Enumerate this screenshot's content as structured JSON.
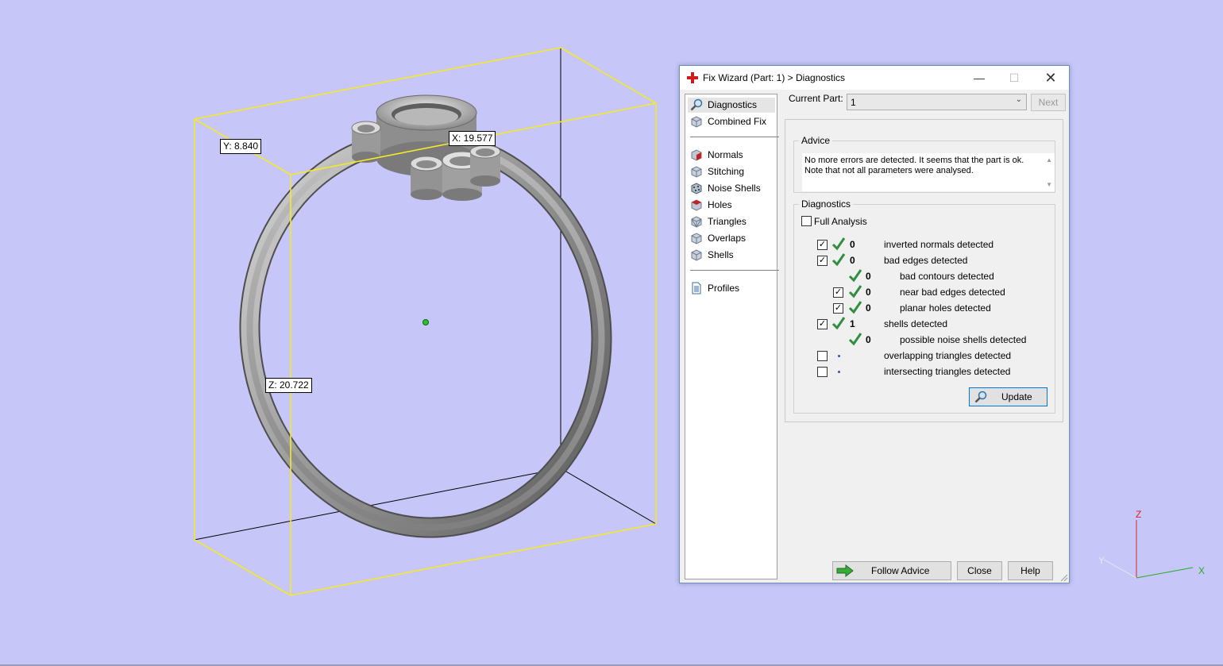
{
  "viewport": {
    "labels": {
      "y": "Y: 8.840",
      "x": "X: 19.577",
      "z": "Z: 20.722"
    },
    "axes": {
      "z": "Z",
      "y": "Y",
      "x": "X"
    }
  },
  "dialog": {
    "title": "Fix Wizard (Part: 1) > Diagnostics",
    "nav": {
      "top": [
        {
          "label": "Diagnostics",
          "icon": "magnifier-icon",
          "selected": true
        },
        {
          "label": "Combined Fix",
          "icon": "cube-icon"
        }
      ],
      "middle": [
        {
          "label": "Normals",
          "icon": "normals-cube-icon"
        },
        {
          "label": "Stitching",
          "icon": "stitching-cube-icon"
        },
        {
          "label": "Noise Shells",
          "icon": "noise-shells-icon"
        },
        {
          "label": "Holes",
          "icon": "holes-cube-icon"
        },
        {
          "label": "Triangles",
          "icon": "triangles-cube-icon"
        },
        {
          "label": "Overlaps",
          "icon": "overlaps-cube-icon"
        },
        {
          "label": "Shells",
          "icon": "shells-cube-icon"
        }
      ],
      "bottom": [
        {
          "label": "Profiles",
          "icon": "document-icon"
        }
      ]
    },
    "current_part_label": "Current Part:",
    "current_part_value": "1",
    "next_label": "Next",
    "advice_title": "Advice",
    "advice_text": "No more errors are detected. It seems that the part is ok. Note that not all parameters were analysed.",
    "diagnostics_title": "Diagnostics",
    "full_analysis_label": "Full Analysis",
    "rows": [
      {
        "checkbox": true,
        "checked": true,
        "status": "ok",
        "count": "0",
        "label": "inverted normals detected",
        "indent": 0
      },
      {
        "checkbox": true,
        "checked": true,
        "status": "ok",
        "count": "0",
        "label": "bad edges detected",
        "indent": 0
      },
      {
        "checkbox": false,
        "checked": false,
        "status": "ok",
        "count": "0",
        "label": "bad contours detected",
        "indent": 1
      },
      {
        "checkbox": true,
        "checked": true,
        "status": "ok",
        "count": "0",
        "label": "near bad edges detected",
        "indent": 1
      },
      {
        "checkbox": true,
        "checked": true,
        "status": "ok",
        "count": "0",
        "label": "planar holes detected",
        "indent": 1
      },
      {
        "checkbox": true,
        "checked": true,
        "status": "ok",
        "count": "1",
        "label": "shells detected",
        "indent": 0
      },
      {
        "checkbox": false,
        "checked": false,
        "status": "ok",
        "count": "0",
        "label": "possible noise shells detected",
        "indent": 1
      },
      {
        "checkbox": true,
        "checked": false,
        "status": "dot",
        "count": "",
        "label": "overlapping triangles detected",
        "indent": 0
      },
      {
        "checkbox": true,
        "checked": false,
        "status": "dot",
        "count": "",
        "label": "intersecting triangles detected",
        "indent": 0
      }
    ],
    "update_label": "Update",
    "follow_advice_label": "Follow Advice",
    "close_label": "Close",
    "help_label": "Help"
  }
}
